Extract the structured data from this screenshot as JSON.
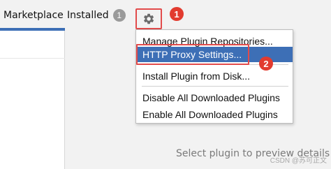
{
  "tabs": {
    "marketplace": "Marketplace",
    "installed": "Installed",
    "installed_badge": "1"
  },
  "toolbar": {
    "settings_icon": "gear-icon"
  },
  "callouts": {
    "one": "1",
    "two": "2"
  },
  "menu": {
    "items": [
      {
        "label": "Manage Plugin Repositories..."
      },
      {
        "label": "HTTP Proxy Settings..."
      },
      {
        "label": "Install Plugin from Disk..."
      },
      {
        "label": "Disable All Downloaded Plugins"
      },
      {
        "label": "Enable All Downloaded Plugins"
      }
    ]
  },
  "main": {
    "preview_text": "Select plugin to preview details"
  },
  "watermark": {
    "text": "CSDN @苏可正文"
  },
  "colors": {
    "accent": "#3d6fb6",
    "callout": "#e23b2f",
    "highlight_border": "#e24b4b"
  }
}
